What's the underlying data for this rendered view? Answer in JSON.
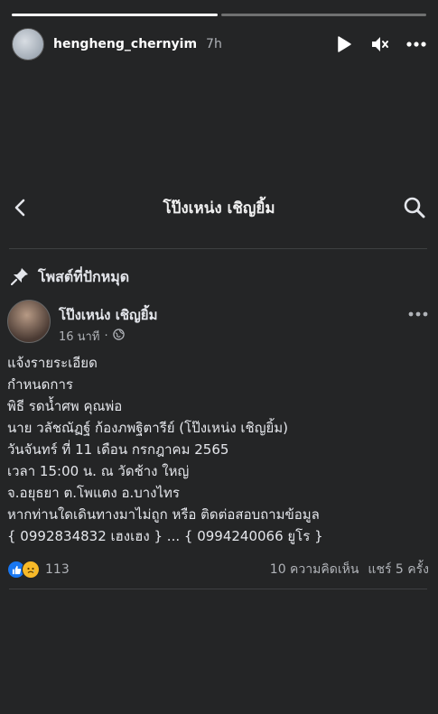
{
  "story": {
    "username": "hengheng_chernyim",
    "time_ago": "7h",
    "progress": [
      1.0,
      0.0
    ],
    "icons": {
      "play": "play-icon",
      "mute": "mute-icon",
      "more": "more-icon"
    }
  },
  "header": {
    "title": "โป๊งเหน่ง เชิญยิ้ม",
    "icons": {
      "back": "back-chevron-icon",
      "search": "search-icon"
    }
  },
  "pinned": {
    "label": "โพสต์ที่ปักหมุด",
    "icon": "pin-icon"
  },
  "post": {
    "author": "โป๊งเหน่ง เชิญยิ้ม",
    "time": "16 นาที",
    "privacy_icon": "globe-icon",
    "body_lines": [
      "แจ้งรายระเอียด",
      "กำหนดการ",
      "พิธี รดน้ำศพ คุณพ่อ",
      "นาย วลัชณัฏฐ์ ก้องภพฐิตารีย์ (โป๊งเหน่ง เชิญยิ้ม)",
      "วันจันทร์ ที่ 11 เดือน กรกฎาคม 2565",
      "เวลา 15:00 น. ณ วัดช้าง ใหญ่",
      "จ.อยุธยา ต.โพแตง อ.บางไทร",
      "หากท่านใดเดินทางมาไม่ถูก หรือ ติดต่อสอบถามข้อมูล",
      "{ 0992834832 เฮงเฮง } ... { 0994240066 ยูโร }"
    ],
    "reactions_count": "113",
    "reaction_icons": [
      "like-icon",
      "sad-icon"
    ],
    "comments": "10 ความคิดเห็น",
    "shares": "แชร์ 5 ครั้ง"
  },
  "colors": {
    "background": "#242526",
    "text": "#e4e6eb",
    "muted": "#b0b3b8",
    "like": "#1877f2",
    "sad": "#f7b928"
  }
}
